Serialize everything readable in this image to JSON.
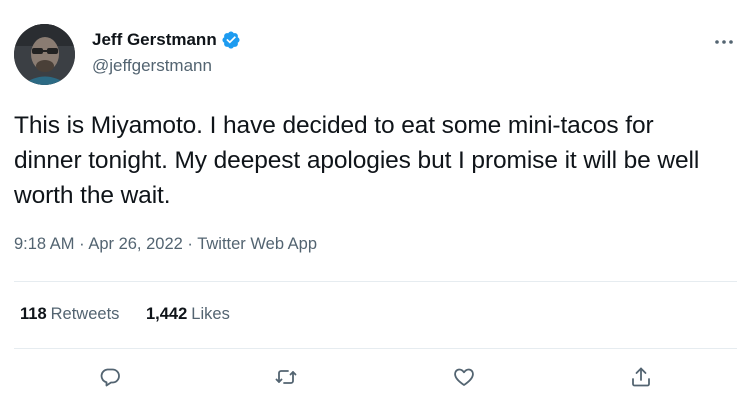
{
  "author": {
    "display_name": "Jeff Gerstmann",
    "handle": "@jeffgerstmann",
    "verified": true
  },
  "tweet": {
    "text": "This is Miyamoto. I have decided to eat some mini-tacos for dinner tonight. My deepest apologies but I promise it will be well worth the wait.",
    "time": "9:18 AM",
    "separator": "·",
    "date": "Apr 26, 2022",
    "source": "Twitter Web App"
  },
  "stats": {
    "retweets_count": "118",
    "retweets_label": "Retweets",
    "likes_count": "1,442",
    "likes_label": "Likes"
  },
  "icons": {
    "more": "more-horizontal-icon",
    "verified": "verified-badge-icon",
    "reply": "reply-icon",
    "retweet": "retweet-icon",
    "like": "heart-icon",
    "share": "share-icon"
  },
  "colors": {
    "text_primary": "#0f1419",
    "text_secondary": "#536471",
    "verified_blue": "#1d9bf0",
    "divider": "#e6ecf0"
  }
}
